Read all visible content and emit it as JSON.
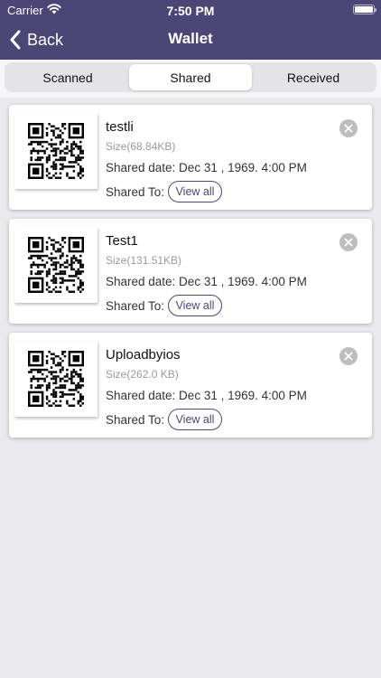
{
  "status_bar": {
    "carrier": "Carrier",
    "time": "7:50 PM"
  },
  "nav": {
    "back_label": "Back",
    "title": "Wallet"
  },
  "tabs": [
    {
      "label": "Scanned",
      "active": false
    },
    {
      "label": "Shared",
      "active": true
    },
    {
      "label": "Received",
      "active": false
    }
  ],
  "items": [
    {
      "name": "testli",
      "size": "Size(68.84KB)",
      "date": "Shared date: Dec 31 , 1969. 4:00 PM",
      "shared_to_label": "Shared To:",
      "view_all_label": "View all"
    },
    {
      "name": "Test1",
      "size": "Size(131.51KB)",
      "date": "Shared date: Dec 31 , 1969. 4:00 PM",
      "shared_to_label": "Shared To:",
      "view_all_label": "View all"
    },
    {
      "name": "Uploadbyios",
      "size": "Size(262.0 KB)",
      "date": "Shared date: Dec 31 , 1969. 4:00 PM",
      "shared_to_label": "Shared To:",
      "view_all_label": "View all"
    }
  ],
  "colors": {
    "header": "#4a4676",
    "accent": "#4a4676",
    "background": "#e9e9ee"
  },
  "icons": {
    "back": "chevron-left-icon",
    "remove": "close-circle-icon",
    "qr": "qr-code-icon",
    "wifi": "wifi-icon",
    "battery": "battery-icon"
  }
}
